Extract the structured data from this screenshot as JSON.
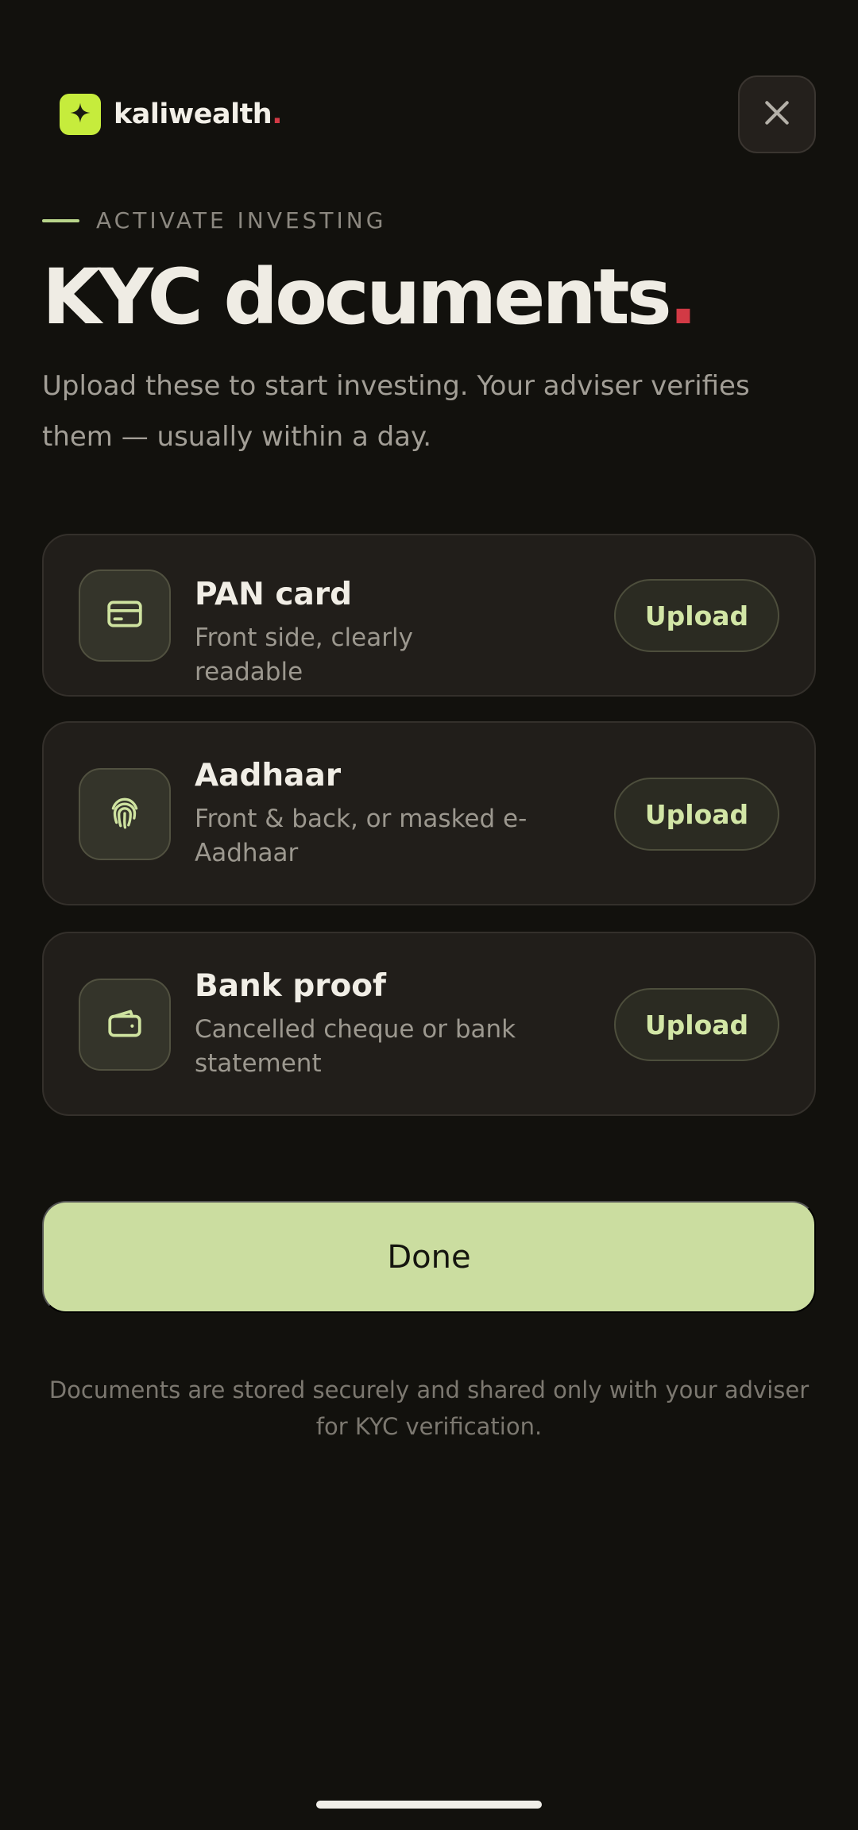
{
  "brand": {
    "name": "kaliwealth",
    "dot": ".",
    "logo_icon": "sparkle-icon",
    "logo_color": "#c6ec3c"
  },
  "header": {
    "close_icon": "close-icon"
  },
  "eyebrow": "ACTIVATE INVESTING",
  "title": {
    "text": "KYC documents",
    "dot": "."
  },
  "subtitle": "Upload these to start investing. Your adviser verifies them — usually within a day.",
  "documents": [
    {
      "title": "PAN card",
      "description": "Front side, clearly readable",
      "icon": "credit-card-icon",
      "action_label": "Upload"
    },
    {
      "title": "Aadhaar",
      "description": "Front & back, or masked e-Aadhaar",
      "icon": "fingerprint-icon",
      "action_label": "Upload"
    },
    {
      "title": "Bank proof",
      "description": "Cancelled cheque or bank statement",
      "icon": "wallet-icon",
      "action_label": "Upload"
    }
  ],
  "done_label": "Done",
  "footnote": "Documents are stored securely and shared only with your adviser for KYC verification.",
  "colors": {
    "background": "#12110d",
    "accent": "#cbdda0",
    "brand_dot": "#d23a45",
    "card": "#211e1a"
  }
}
